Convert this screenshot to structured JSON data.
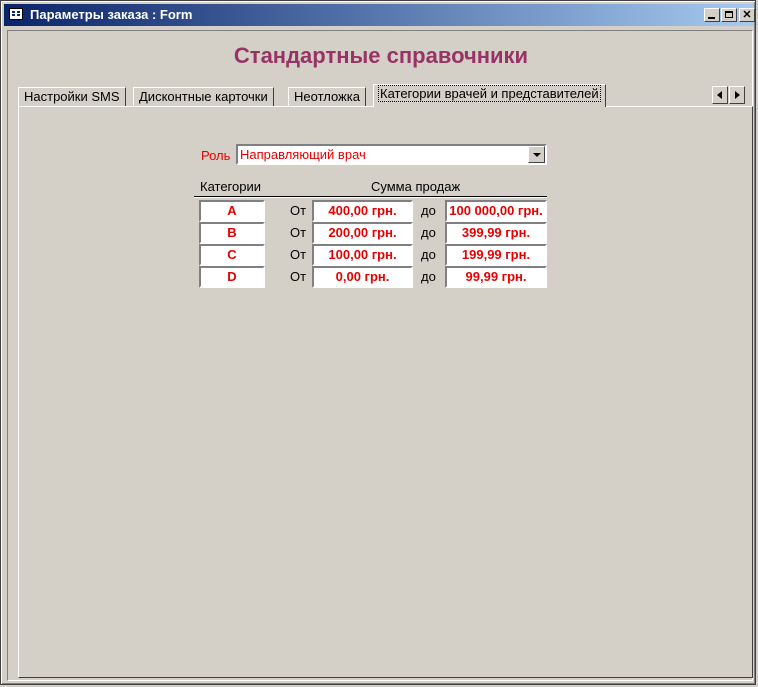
{
  "window": {
    "title": "Параметры заказа : Form"
  },
  "heading": "Стандартные справочники",
  "tabs": [
    {
      "label": "Настройки SMS"
    },
    {
      "label": "Дисконтные карточки"
    },
    {
      "label": "Неотложка"
    },
    {
      "label": "Категории врачей и представителей"
    }
  ],
  "role": {
    "label": "Роль",
    "value": "Направляющий врач"
  },
  "table": {
    "headers": {
      "categories": "Категории",
      "sales_sum": "Сумма продаж"
    },
    "from_label": "От",
    "to_label": "до",
    "rows": [
      {
        "category": "A",
        "from": "400,00 грн.",
        "to": "100 000,00 грн."
      },
      {
        "category": "B",
        "from": "200,00 грн.",
        "to": "399,99 грн."
      },
      {
        "category": "C",
        "from": "100,00 грн.",
        "to": "199,99 грн."
      },
      {
        "category": "D",
        "from": "0,00 грн.",
        "to": "99,99 грн."
      }
    ]
  },
  "colors": {
    "accent_heading": "#993366",
    "value_text": "#e60000",
    "titlebar": "#0a246a"
  }
}
